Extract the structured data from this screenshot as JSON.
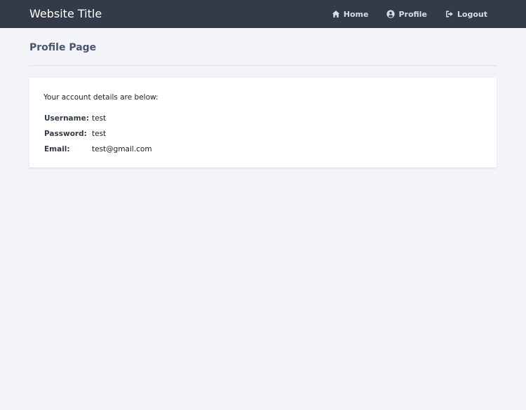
{
  "header": {
    "site_title": "Website Title",
    "nav": [
      {
        "label": "Home",
        "icon": "home-icon"
      },
      {
        "label": "Profile",
        "icon": "user-circle-icon"
      },
      {
        "label": "Logout",
        "icon": "logout-icon"
      }
    ]
  },
  "main": {
    "page_title": "Profile Page",
    "card": {
      "intro": "Your account details are below:",
      "details": [
        {
          "label": "Username:",
          "value": "test"
        },
        {
          "label": "Password:",
          "value": "test"
        },
        {
          "label": "Email:",
          "value": "test@gmail.com"
        }
      ]
    }
  },
  "colors": {
    "nav_bg": "#333b48",
    "page_bg": "#f3f4f7",
    "title_color": "#4a5570"
  }
}
